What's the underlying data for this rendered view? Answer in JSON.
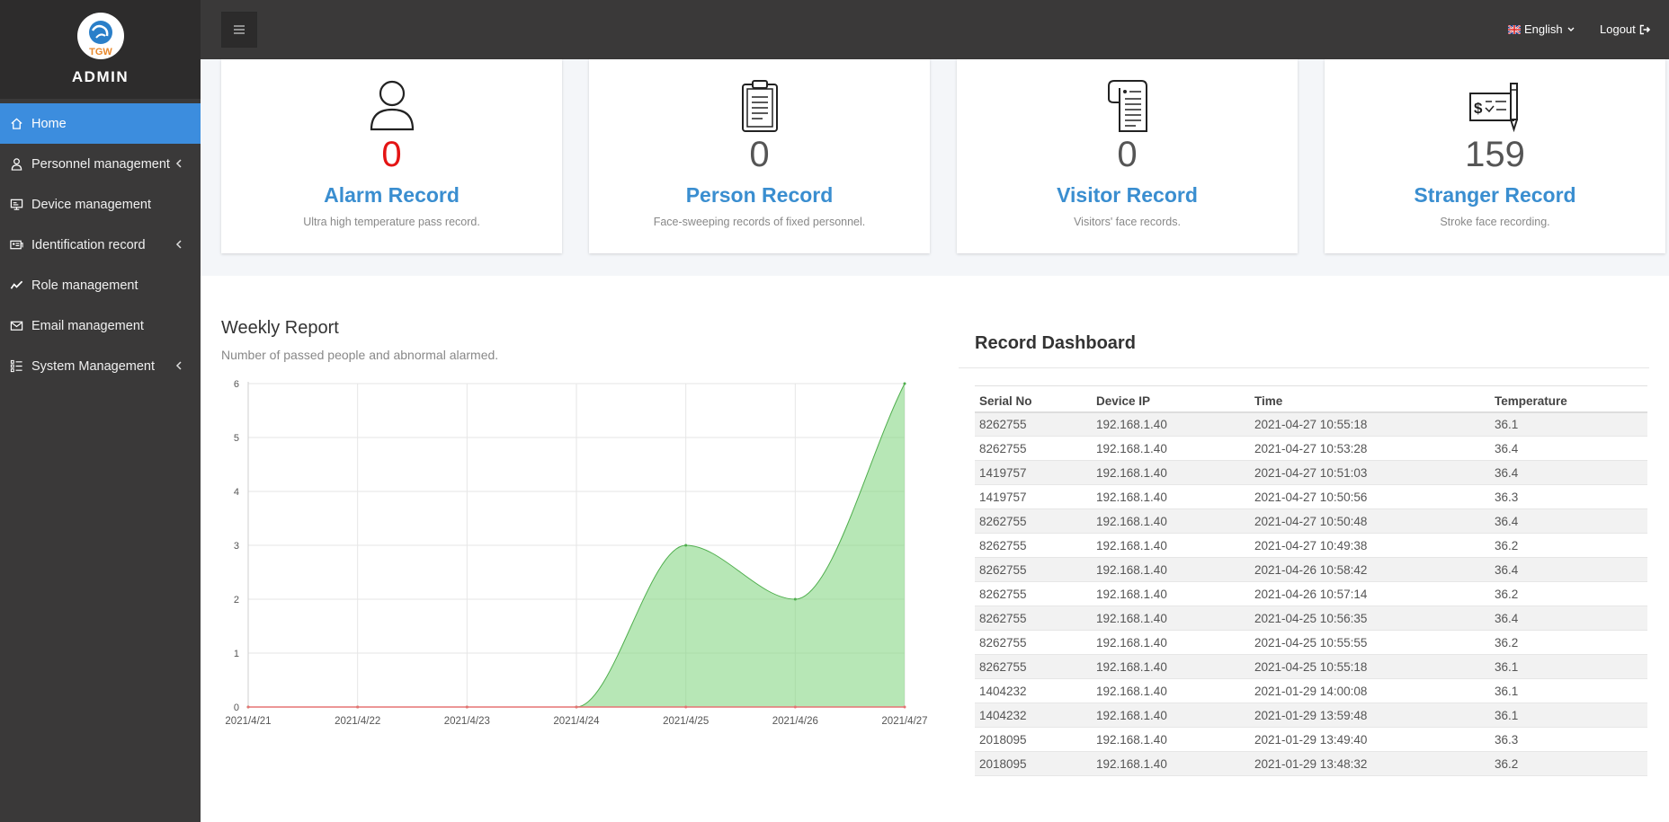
{
  "brand": {
    "logo_text": "TGW",
    "name": "ADMIN"
  },
  "sidebar": {
    "items": [
      {
        "label": "Home",
        "icon": "home-icon",
        "active": true
      },
      {
        "label": "Personnel management",
        "icon": "user-icon",
        "has_submenu": true
      },
      {
        "label": "Device management",
        "icon": "device-icon"
      },
      {
        "label": "Identification record",
        "icon": "id-card-icon",
        "has_submenu": true
      },
      {
        "label": "Role management",
        "icon": "line-chart-icon"
      },
      {
        "label": "Email management",
        "icon": "envelope-icon"
      },
      {
        "label": "System Management",
        "icon": "settings-list-icon",
        "has_submenu": true
      }
    ]
  },
  "header": {
    "menu_toggle_icon": "hamburger-icon",
    "language": "English",
    "language_flag": "uk-flag-icon",
    "logout": "Logout"
  },
  "cards": [
    {
      "value": "0",
      "title": "Alarm Record",
      "desc": "Ultra high temperature pass record.",
      "icon": "person-icon",
      "value_color": "#e41414"
    },
    {
      "value": "0",
      "title": "Person Record",
      "desc": "Face-sweeping records of fixed personnel.",
      "icon": "clipboard-icon"
    },
    {
      "value": "0",
      "title": "Visitor Record",
      "desc": "Visitors' face records.",
      "icon": "document-scroll-icon"
    },
    {
      "value": "159",
      "title": "Stranger Record",
      "desc": "Stroke face recording.",
      "icon": "cheque-pen-icon"
    }
  ],
  "weekly": {
    "title": "Weekly Report",
    "subtitle": "Number of passed people and abnormal alarmed."
  },
  "chart_data": {
    "type": "area",
    "title": "",
    "xlabel": "",
    "ylabel": "",
    "categories": [
      "2021/4/21",
      "2021/4/22",
      "2021/4/23",
      "2021/4/24",
      "2021/4/25",
      "2021/4/26",
      "2021/4/27"
    ],
    "series": [
      {
        "values": [
          0,
          0,
          0,
          0,
          3,
          2,
          6
        ],
        "color": "#7cd47a"
      },
      {
        "values": [
          0,
          0,
          0,
          0,
          0,
          0,
          0
        ],
        "color": "#e57373"
      }
    ],
    "ylim": [
      0,
      6
    ],
    "yticks": [
      0,
      1,
      2,
      3,
      4,
      5,
      6
    ],
    "grid": true,
    "smooth": true
  },
  "dashboard": {
    "title": "Record Dashboard",
    "columns": [
      "Serial No",
      "Device IP",
      "Time",
      "Temperature"
    ],
    "rows": [
      [
        "8262755",
        "192.168.1.40",
        "2021-04-27 10:55:18",
        "36.1"
      ],
      [
        "8262755",
        "192.168.1.40",
        "2021-04-27 10:53:28",
        "36.4"
      ],
      [
        "1419757",
        "192.168.1.40",
        "2021-04-27 10:51:03",
        "36.4"
      ],
      [
        "1419757",
        "192.168.1.40",
        "2021-04-27 10:50:56",
        "36.3"
      ],
      [
        "8262755",
        "192.168.1.40",
        "2021-04-27 10:50:48",
        "36.4"
      ],
      [
        "8262755",
        "192.168.1.40",
        "2021-04-27 10:49:38",
        "36.2"
      ],
      [
        "8262755",
        "192.168.1.40",
        "2021-04-26 10:58:42",
        "36.4"
      ],
      [
        "8262755",
        "192.168.1.40",
        "2021-04-26 10:57:14",
        "36.2"
      ],
      [
        "8262755",
        "192.168.1.40",
        "2021-04-25 10:56:35",
        "36.4"
      ],
      [
        "8262755",
        "192.168.1.40",
        "2021-04-25 10:55:55",
        "36.2"
      ],
      [
        "8262755",
        "192.168.1.40",
        "2021-04-25 10:55:18",
        "36.1"
      ],
      [
        "1404232",
        "192.168.1.40",
        "2021-01-29 14:00:08",
        "36.1"
      ],
      [
        "1404232",
        "192.168.1.40",
        "2021-01-29 13:59:48",
        "36.1"
      ],
      [
        "2018095",
        "192.168.1.40",
        "2021-01-29 13:49:40",
        "36.3"
      ],
      [
        "2018095",
        "192.168.1.40",
        "2021-01-29 13:48:32",
        "36.2"
      ]
    ]
  }
}
